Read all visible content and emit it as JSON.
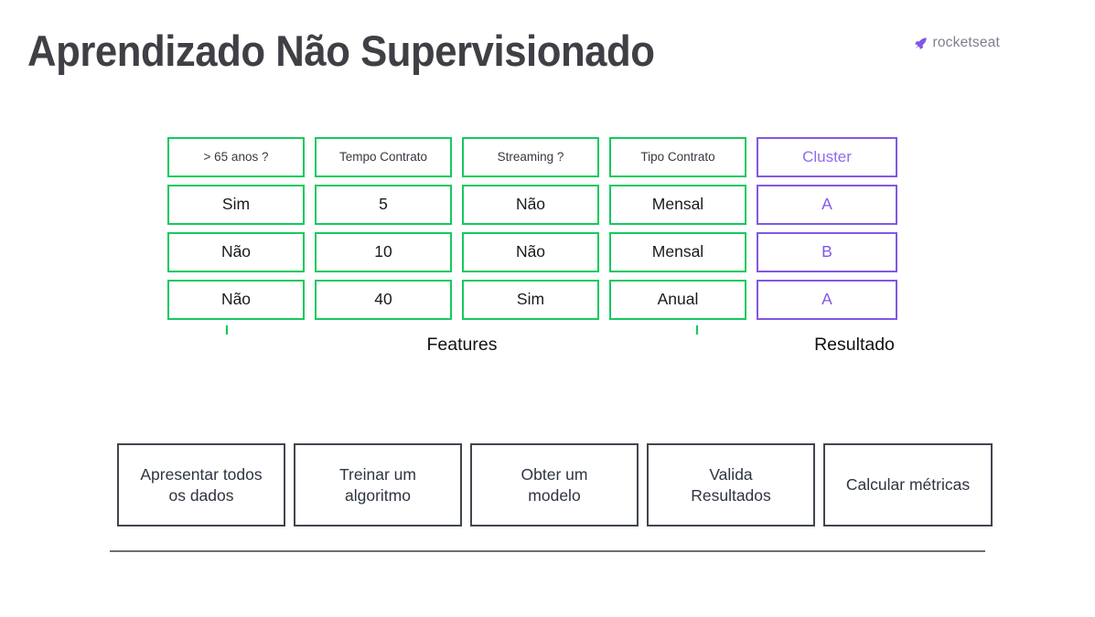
{
  "slide": {
    "title": "Aprendizado Não Supervisionado",
    "brand": {
      "name": "rocketseat",
      "icon": "rocket-icon",
      "color": "#8257e5"
    },
    "colors": {
      "feature_green": "#16c95f",
      "result_purple": "#8257e5",
      "title_gray": "#3f3f46",
      "box_border": "#41464e",
      "divider_gray": "#6e6e78"
    }
  },
  "table": {
    "feature_headers": [
      "> 65 anos ?",
      "Tempo Contrato",
      "Streaming ?",
      "Tipo Contrato"
    ],
    "result_header": "Cluster",
    "rows": [
      {
        "features": [
          "Sim",
          "5",
          "Não",
          "Mensal"
        ],
        "result": "A"
      },
      {
        "features": [
          "Não",
          "10",
          "Não",
          "Mensal"
        ],
        "result": "B"
      },
      {
        "features": [
          "Não",
          "40",
          "Sim",
          "Anual"
        ],
        "result": "A"
      }
    ],
    "features_label": "Features",
    "result_label": "Resultado"
  },
  "process": {
    "steps": [
      "Apresentar todos\nos dados",
      "Treinar um\nalgoritmo",
      "Obter um\nmodelo",
      "Valida\nResultados",
      "Calcular métricas"
    ]
  }
}
